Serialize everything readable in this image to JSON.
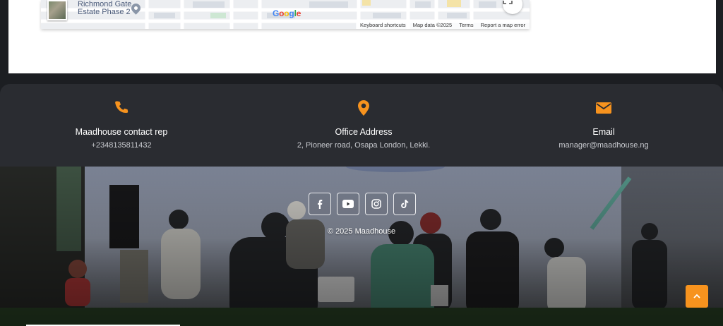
{
  "map": {
    "place_label_line1": "Richmond Gate",
    "place_label_line2": "Estate Phase 2",
    "logo_letters": [
      "G",
      "o",
      "o",
      "g",
      "l",
      "e"
    ],
    "footer_links": [
      "Keyboard shortcuts",
      "Map data ©2025",
      "Terms",
      "Report a map error"
    ]
  },
  "contacts": [
    {
      "icon": "phone-icon",
      "title": "Maadhouse contact rep",
      "value": "+2348135811432"
    },
    {
      "icon": "location-pin-icon",
      "title": "Office Address",
      "value": "2, Pioneer road, Osapa London, Lekki."
    },
    {
      "icon": "envelope-icon",
      "title": "Email",
      "value": "manager@maadhouse.ng"
    }
  ],
  "colors": {
    "accent": "#f7931e",
    "bar_bg": "#2a2c31",
    "page_bg": "#1c1e22"
  },
  "social": [
    {
      "icon": "facebook-icon"
    },
    {
      "icon": "youtube-icon"
    },
    {
      "icon": "instagram-icon"
    },
    {
      "icon": "tiktok-icon"
    }
  ],
  "footer": {
    "copyright": "© 2025 Maadhouse"
  },
  "back_to_top": {
    "icon": "chevron-up-icon"
  }
}
